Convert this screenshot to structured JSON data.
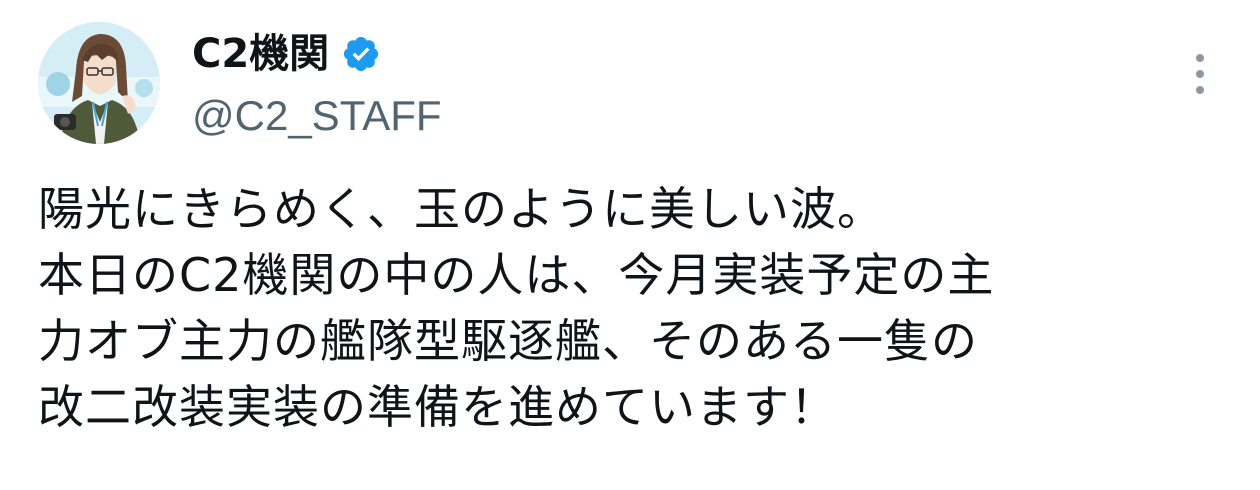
{
  "tweet": {
    "author": {
      "display_name": "C2機関",
      "handle": "@C2_STAFF",
      "verified_icon": "verified-badge-icon",
      "avatar_icon": "profile-avatar"
    },
    "more_icon": "more-vertical-icon",
    "text_lines": [
      "陽光にきらめく、玉のように美しい波。",
      "本日のC2機関の中の人は、今月実装予定の主",
      "力オブ主力の艦隊型駆逐艦、そのある一隻の",
      "改二改装実装の準備を進めています！"
    ]
  },
  "colors": {
    "text": "#0f1419",
    "secondary": "#536471",
    "verified": "#1d9bf0",
    "more_dots": "#8b98a5"
  }
}
